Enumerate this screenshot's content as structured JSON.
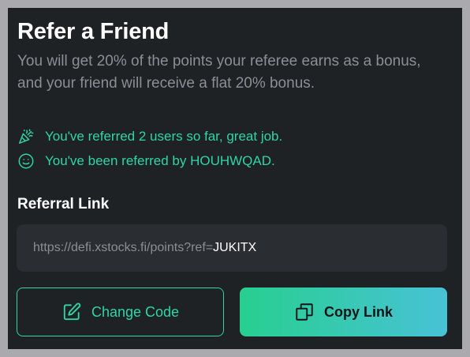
{
  "refer": {
    "title": "Refer a Friend",
    "description": "You will get 20% of the points your referee earns as a bonus, and your friend will receive a flat 20% bonus."
  },
  "status": {
    "referred_count_text": "You've referred 2 users so far, great job.",
    "referred_by_text": "You've been referred by HOUHWQAD.",
    "icons": [
      "party-popper-icon",
      "smiley-icon"
    ]
  },
  "referral_link": {
    "label": "Referral Link",
    "base_url": "https://defi.xstocks.fi/points?ref=",
    "code": "JUKITX"
  },
  "actions": {
    "change_code_label": "Change Code",
    "copy_link_label": "Copy Link"
  },
  "colors": {
    "accent": "#2fd5a5",
    "card_bg": "#1f2225",
    "gradient_start": "#27cf8f",
    "gradient_end": "#48c2d6"
  }
}
